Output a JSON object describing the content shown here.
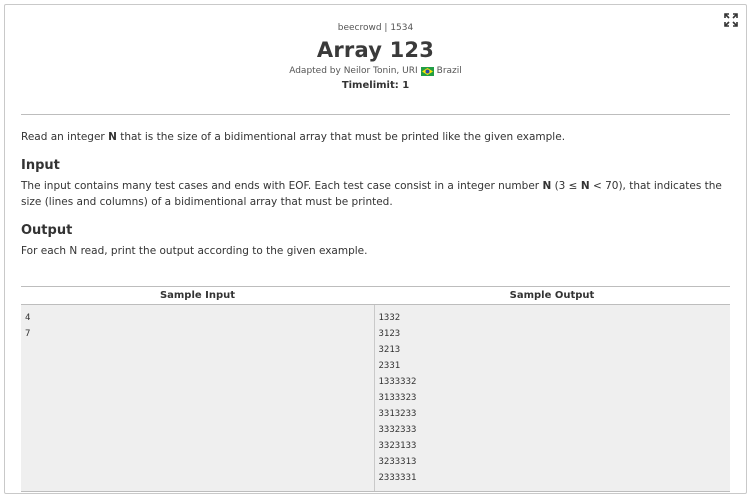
{
  "header": {
    "judge": "beecrowd | 1534",
    "title": "Array 123",
    "author_prefix": "Adapted by Neilor Tonin, URI",
    "country": "Brazil",
    "timelimit": "Timelimit: 1"
  },
  "statement": {
    "intro_before": "Read an integer ",
    "intro_var": "N",
    "intro_after": " that is the size of a bidimentional array that must be printed like the given example.",
    "input_heading": "Input",
    "input_before": "The input contains many test cases and ends with EOF. Each test case consist in a integer number ",
    "input_var": "N",
    "input_mid1": " (3 ≤ ",
    "input_var2": "N",
    "input_after": " < 70), that indicates the size (lines and columns) of a bidimentional array that must be printed.",
    "output_heading": "Output",
    "output_text": "For each N read, print the output according to the given example."
  },
  "samples": {
    "input_header": "Sample Input",
    "output_header": "Sample Output",
    "input_lines": [
      "4",
      "7"
    ],
    "output_lines": [
      "1332",
      "3123",
      "3213",
      "2331",
      "1333332",
      "3133323",
      "3313233",
      "3332333",
      "3323133",
      "3233313",
      "2333331"
    ]
  },
  "colors": {
    "flag_green": "#229e45",
    "flag_yellow": "#f8e509",
    "flag_blue": "#2b49a3"
  },
  "icons": {
    "expand": "expand-icon"
  }
}
